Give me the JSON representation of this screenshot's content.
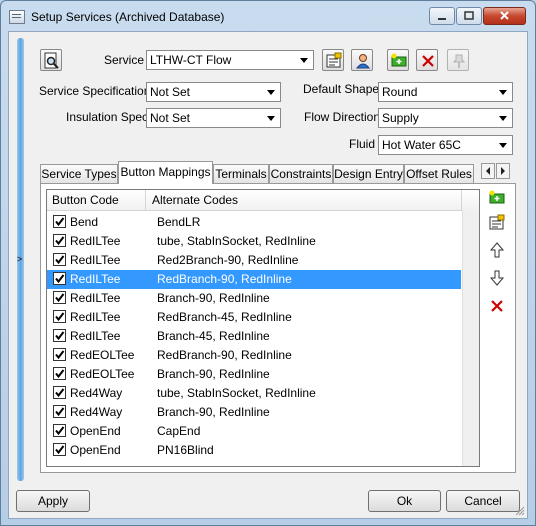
{
  "window": {
    "title": "Setup Services (Archived Database)"
  },
  "service": {
    "label": "Service",
    "value": "LTHW-CT Flow"
  },
  "service_spec": {
    "label": "Service Specification",
    "value": "Not Set"
  },
  "insulation_spec": {
    "label": "Insulation Spec",
    "value": "Not Set"
  },
  "default_shape": {
    "label": "Default Shape",
    "value": "Round"
  },
  "flow_direction": {
    "label": "Flow Direction",
    "value": "Supply"
  },
  "fluid": {
    "label": "Fluid",
    "value": "Hot Water 65C"
  },
  "tabs": [
    {
      "label": "Service Types"
    },
    {
      "label": "Button Mappings"
    },
    {
      "label": "Terminals"
    },
    {
      "label": "Constraints"
    },
    {
      "label": "Design Entry"
    },
    {
      "label": "Offset Rules"
    }
  ],
  "active_tab": "Button Mappings",
  "grid": {
    "headers": {
      "code": "Button Code",
      "alt": "Alternate Codes"
    },
    "rows": [
      {
        "code": "Bend",
        "alt": "BendLR",
        "checked": true
      },
      {
        "code": "RedILTee",
        "alt": "tube, StabInSocket, RedInline",
        "checked": true
      },
      {
        "code": "RedILTee",
        "alt": "Red2Branch-90, RedInline",
        "checked": true
      },
      {
        "code": "RedILTee",
        "alt": "RedBranch-90, RedInline",
        "checked": true,
        "selected": true
      },
      {
        "code": "RedILTee",
        "alt": "Branch-90, RedInline",
        "checked": true
      },
      {
        "code": "RedILTee",
        "alt": "RedBranch-45, RedInline",
        "checked": true
      },
      {
        "code": "RedILTee",
        "alt": "Branch-45, RedInline",
        "checked": true
      },
      {
        "code": "RedEOLTee",
        "alt": "RedBranch-90, RedInline",
        "checked": true
      },
      {
        "code": "RedEOLTee",
        "alt": "Branch-90, RedInline",
        "checked": true
      },
      {
        "code": "Red4Way",
        "alt": "tube, StabInSocket, RedInline",
        "checked": true
      },
      {
        "code": "Red4Way",
        "alt": "Branch-90, RedInline",
        "checked": true
      },
      {
        "code": "OpenEnd",
        "alt": "CapEnd",
        "checked": true
      },
      {
        "code": "OpenEnd",
        "alt": "PN16Blind",
        "checked": true
      }
    ]
  },
  "buttons": {
    "apply": "Apply",
    "ok": "Ok",
    "cancel": "Cancel"
  },
  "splitter_arrow": ">",
  "colors": {
    "selection": "#3399ff",
    "delete": "#cc0000"
  }
}
